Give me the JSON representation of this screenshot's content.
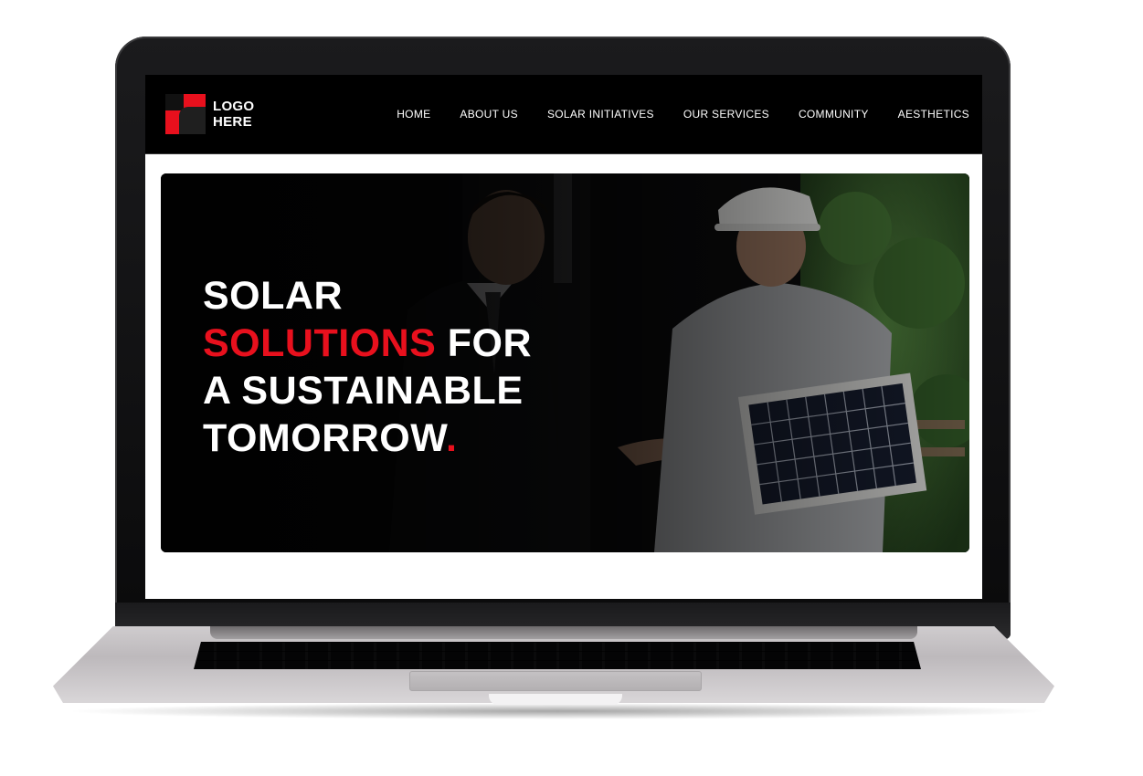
{
  "site": {
    "logo": {
      "line1": "LOGO",
      "line2": "HERE"
    },
    "nav": [
      {
        "label": "HOME"
      },
      {
        "label": "ABOUT US"
      },
      {
        "label": "SOLAR INITIATIVES"
      },
      {
        "label": "OUR SERVICES"
      },
      {
        "label": "COMMUNITY"
      },
      {
        "label": "AESTHETICS"
      }
    ],
    "hero": {
      "line1": "SOLAR",
      "line2_accent": "SOLUTIONS",
      "line2_rest": " FOR",
      "line3": "A SUSTAINABLE",
      "line4": "TOMORROW",
      "line4_dot": "."
    }
  },
  "colors": {
    "accent": "#e8101d",
    "header_bg": "#000000",
    "hero_text": "#ffffff",
    "laptop_body": "#c9c6c8"
  },
  "icons": {
    "logo": "logo-mark-icon"
  }
}
